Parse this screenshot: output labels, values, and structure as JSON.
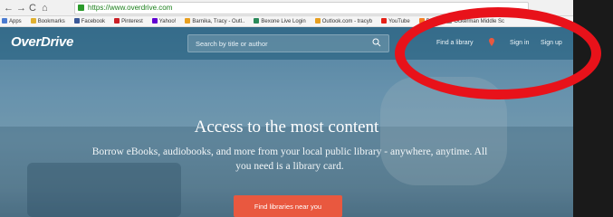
{
  "browser": {
    "url": "https://www.overdrive.com",
    "bookmarks": [
      {
        "label": "Apps",
        "icon": "apps-icon",
        "color": "#4a7bd0"
      },
      {
        "label": "Bookmarks",
        "icon": "star-icon",
        "color": "#e0b030"
      },
      {
        "label": "Facebook",
        "icon": "facebook-icon",
        "color": "#3b5998"
      },
      {
        "label": "Pinterest",
        "icon": "pinterest-icon",
        "color": "#cb2027"
      },
      {
        "label": "Yahoo!",
        "icon": "yahoo-icon",
        "color": "#6001d2"
      },
      {
        "label": "Barnika, Tracy - Outl..",
        "icon": "outlook-icon",
        "color": "#e8a020"
      },
      {
        "label": "Bexone Live Login",
        "icon": "bexone-icon",
        "color": "#2a8a5a"
      },
      {
        "label": "Outlook.com - tracyb",
        "icon": "outlook-icon",
        "color": "#e8a020"
      },
      {
        "label": "YouTube",
        "icon": "youtube-icon",
        "color": "#e62117"
      },
      {
        "label": "PNC",
        "icon": "pnc-icon",
        "color": "#f58025"
      },
      {
        "label": "Ockerman Middle Sc",
        "icon": "school-icon",
        "color": "#8a8a8a"
      }
    ]
  },
  "header": {
    "logo": "OverDrive",
    "search_placeholder": "Search by title or author",
    "find_library": "Find a library",
    "sign_in": "Sign in",
    "sign_up": "Sign up"
  },
  "hero": {
    "title": "Access to the most content",
    "subtitle": "Borrow eBooks, audiobooks, and more from your local public library - anywhere, anytime. All you need is a library card.",
    "cta": "Find libraries near you"
  },
  "colors": {
    "accent": "#e9583f",
    "annotation": "#e8121a",
    "pin": "#e9583f"
  }
}
